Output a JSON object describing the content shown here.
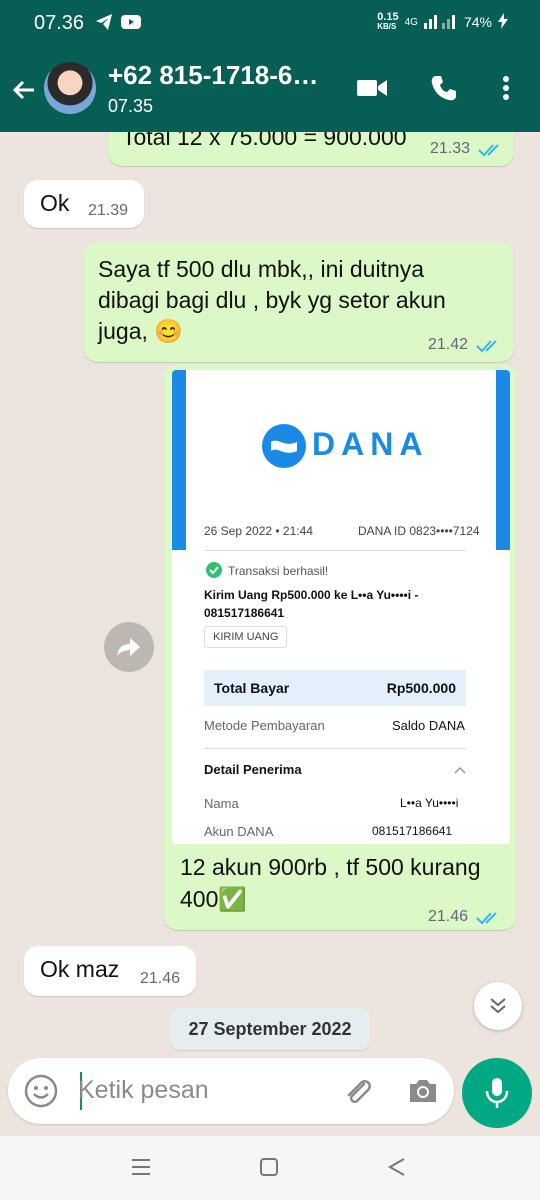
{
  "status_bar": {
    "time": "07.36",
    "net_speed_top": "0.15",
    "net_speed_unit": "KB/S",
    "network": "4G",
    "battery": "74%"
  },
  "header": {
    "contact_name": "+62 815-1718-6…",
    "last_seen": "07.35"
  },
  "messages": [
    {
      "direction": "out",
      "text": "Total 12 x 75.000 = 900.000",
      "time": "21.33",
      "read": true
    },
    {
      "direction": "in",
      "text": "Ok",
      "time": "21.39"
    },
    {
      "direction": "out",
      "text_lines": [
        "Saya tf 500 dlu mbk,, ini duitnya",
        "dibagi bagi dlu , byk yg setor akun",
        "juga, 😊"
      ],
      "time": "21.42",
      "read": true
    },
    {
      "direction": "out",
      "type": "image",
      "caption_lines": [
        "12 akun 900rb , tf 500 kurang",
        "400✅"
      ],
      "time": "21.46",
      "read": true
    },
    {
      "direction": "in",
      "text": "Ok maz",
      "time": "21.46"
    }
  ],
  "receipt": {
    "brand": "DANA",
    "date": "26 Sep 2022 • 21:44",
    "dana_id": "DANA ID 0823••••7124",
    "status": "Transaksi berhasil!",
    "description": "Kirim Uang Rp500.000 ke L••a Yu••••i -",
    "phone": "081517186641",
    "tag": "KIRIM UANG",
    "total_label": "Total Bayar",
    "total_value": "Rp500.000",
    "method_label": "Metode Pembayaran",
    "method_value": "Saldo DANA",
    "detail_title": "Detail Penerima",
    "name_label": "Nama",
    "name_value": "L••a Yu••••i",
    "account_label": "Akun DANA",
    "account_value": "081517186641"
  },
  "date_chip": "27 September 2022",
  "composer": {
    "placeholder": "Ketik pesan"
  },
  "colors": {
    "header": "#075e54",
    "outgoing": "#dcf8c6",
    "incoming": "#ffffff",
    "read_ticks": "#34b7f1",
    "accent": "#00a884",
    "dana_blue": "#1a8ae4"
  }
}
